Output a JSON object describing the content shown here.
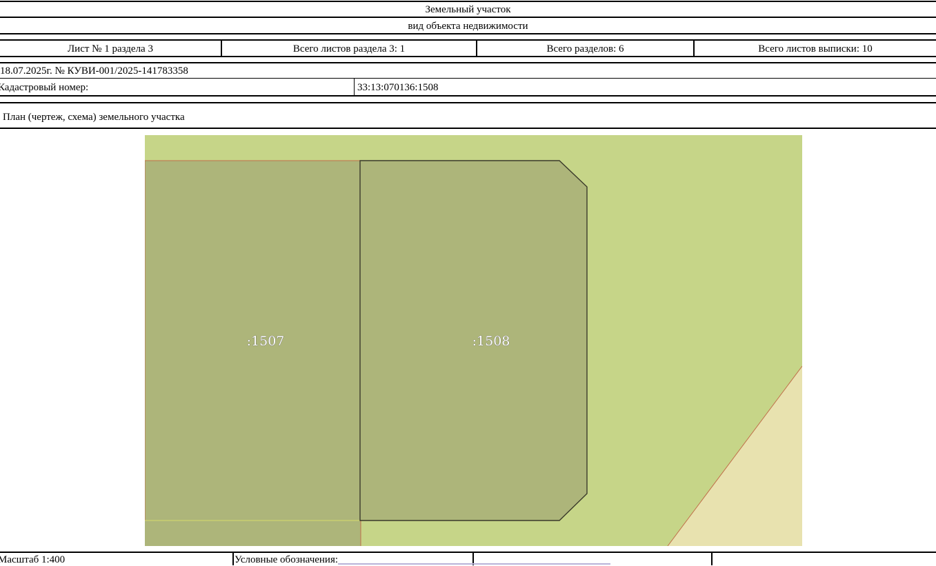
{
  "header": {
    "object_type": "Земельный участок",
    "object_kind_caption": "вид объекта недвижимости"
  },
  "sheet_info": {
    "sheet_label": "Лист № 1 раздела 3",
    "section_sheets_label": "Всего листов раздела 3: 1",
    "sections_label": "Всего разделов: 6",
    "extract_sheets_label": "Всего листов выписки: 10"
  },
  "extract": {
    "date_number": "18.07.2025г. № КУВИ-001/2025-141783358",
    "cadastral_label": "Кадастровый номер:",
    "cadastral_value": "33:13:070136:1508"
  },
  "plan": {
    "title": "План (чертеж, схема) земельного участка",
    "parcels": [
      {
        "label": ":1507",
        "role": "neighbor",
        "fill": "#adb57a"
      },
      {
        "label": ":1508",
        "role": "subject",
        "fill": "#adb57a"
      }
    ],
    "colors": {
      "background": "#c6d588",
      "road": "#e8e2af",
      "border_neighbor": "#c0704a",
      "border_subject": "#3a3a2a"
    }
  },
  "footer": {
    "scale_label": "Масштаб 1:400",
    "legend_label": "Условные обозначения:"
  }
}
